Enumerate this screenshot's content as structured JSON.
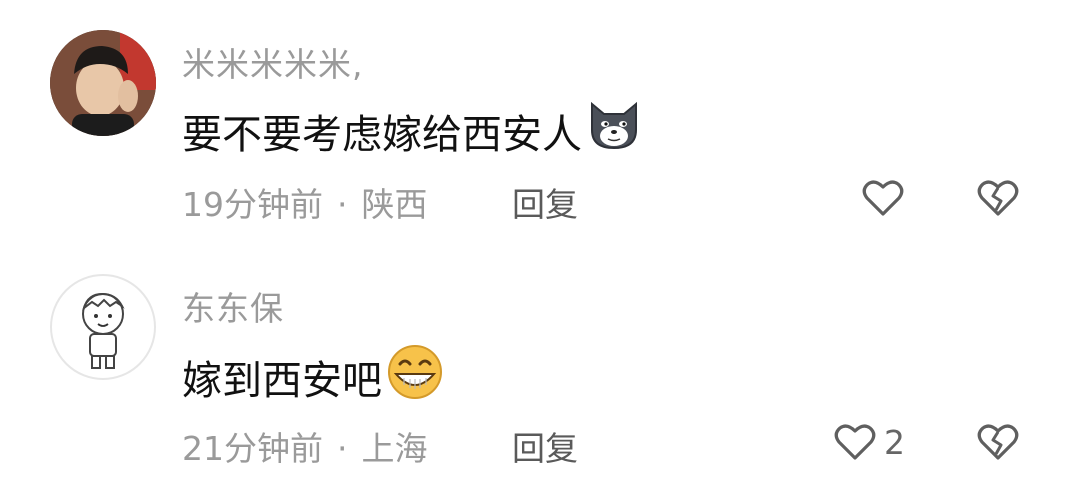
{
  "comments": [
    {
      "username": "米米米米米,",
      "text": "要不要考虑嫁给西安人",
      "emoji": "dog-face-icon",
      "time": "19分钟前",
      "separator": "·",
      "location": "陕西",
      "reply_label": "回复",
      "like_count": ""
    },
    {
      "username": "东东保",
      "text": "嫁到西安吧",
      "emoji": "grinning-face-icon",
      "time": "21分钟前",
      "separator": "·",
      "location": "上海",
      "reply_label": "回复",
      "like_count": "2"
    }
  ],
  "colors": {
    "meta_gray": "#9a9a9a",
    "text_black": "#111111",
    "emoji_yellow": "#f7c24a"
  }
}
